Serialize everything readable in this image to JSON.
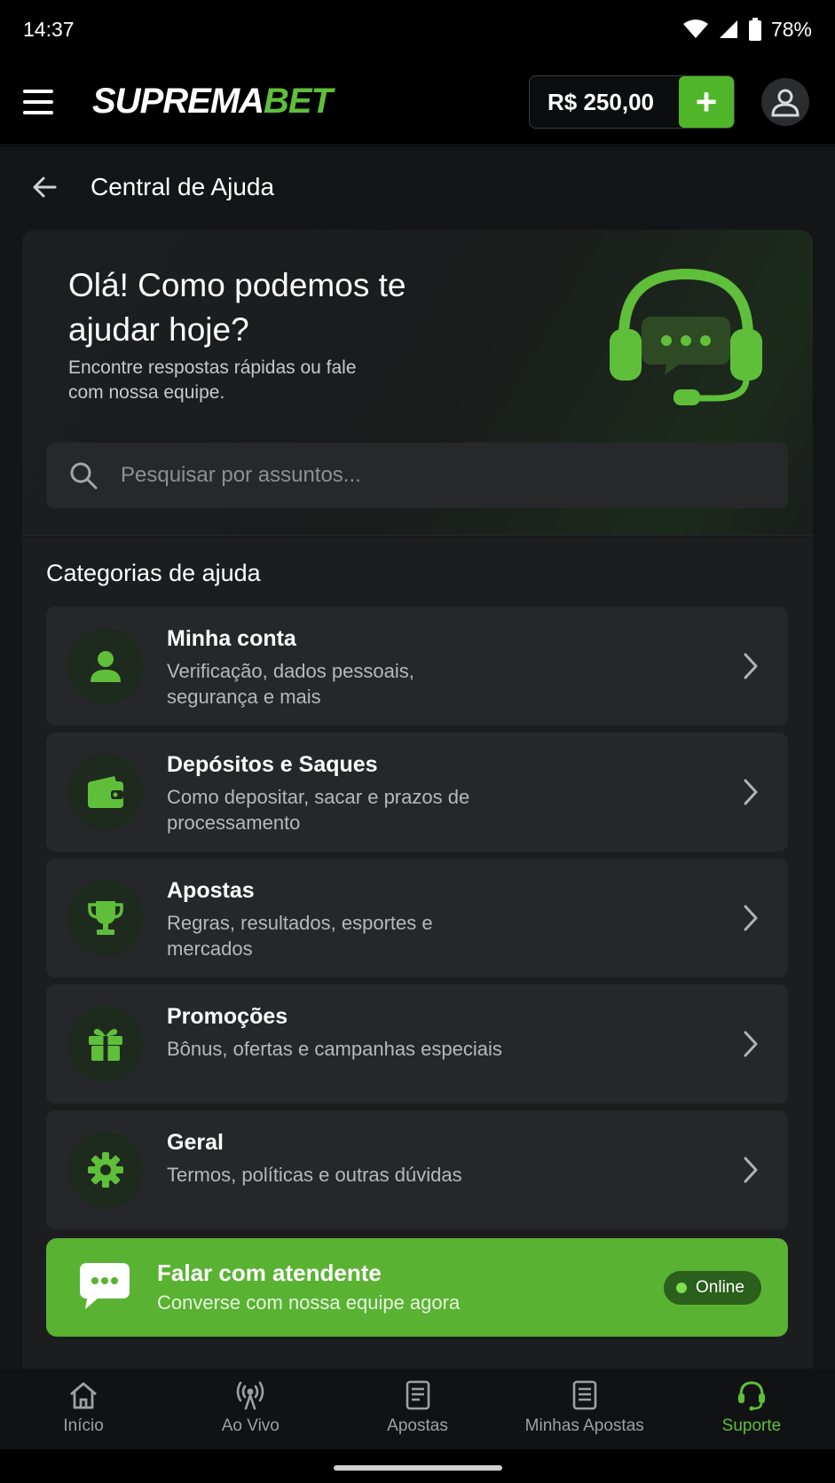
{
  "status_bar": {
    "time": "14:37",
    "battery": "78%"
  },
  "header": {
    "logo_part1": "SUPREMA",
    "logo_part2": "BET",
    "balance": "R$ 250,00",
    "add_label": "+"
  },
  "page": {
    "title": "Central de Ajuda"
  },
  "hero": {
    "title": "Olá! Como podemos te ajudar hoje?",
    "subtitle": "Encontre respostas rápidas ou fale com nossa equipe.",
    "search_placeholder": "Pesquisar por assuntos..."
  },
  "categories": {
    "heading": "Categorias de ajuda",
    "items": [
      {
        "title": "Minha conta",
        "desc": "Verificação, dados pessoais, segurança e mais",
        "icon": "user-icon"
      },
      {
        "title": "Depósitos e Saques",
        "desc": "Como depositar, sacar e prazos de processamento",
        "icon": "wallet-icon"
      },
      {
        "title": "Apostas",
        "desc": "Regras, resultados, esportes e mercados",
        "icon": "trophy-icon"
      },
      {
        "title": "Promoções",
        "desc": "Bônus, ofertas e campanhas especiais",
        "icon": "gift-icon"
      },
      {
        "title": "Geral",
        "desc": "Termos, políticas e outras dúvidas",
        "icon": "gear-icon"
      }
    ]
  },
  "contact": {
    "title": "Falar com atendente",
    "subtitle": "Converse com nossa equipe agora",
    "status": "Online"
  },
  "bottom_nav": {
    "items": [
      {
        "label": "Início",
        "icon": "home-icon"
      },
      {
        "label": "Ao Vivo",
        "icon": "live-icon"
      },
      {
        "label": "Apostas",
        "icon": "bets-icon"
      },
      {
        "label": "Minhas Apostas",
        "icon": "my-bets-icon"
      },
      {
        "label": "Suporte",
        "icon": "support-icon"
      }
    ]
  },
  "colors": {
    "accent": "#5fbf3a",
    "contact_bg": "#59b232",
    "background": "#141516"
  }
}
